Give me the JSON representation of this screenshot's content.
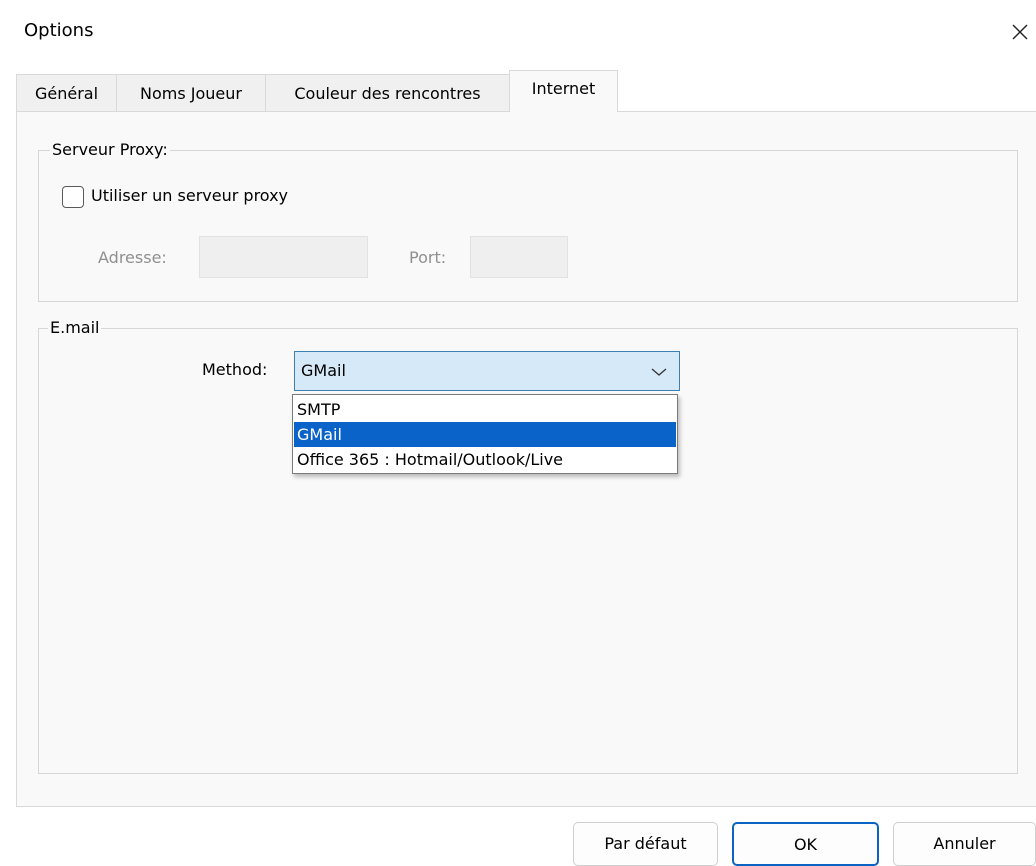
{
  "window": {
    "title": "Options",
    "close_icon": "close-icon"
  },
  "tabs": [
    {
      "label": "Général",
      "active": false
    },
    {
      "label": "Noms Joueur",
      "active": false
    },
    {
      "label": "Couleur des rencontres",
      "active": false
    },
    {
      "label": "Internet",
      "active": true
    }
  ],
  "proxy": {
    "group_label": "Serveur Proxy:",
    "use_proxy_label": "Utiliser un serveur proxy",
    "use_proxy_checked": false,
    "address_label": "Adresse:",
    "address_value": "",
    "port_label": "Port:",
    "port_value": ""
  },
  "email": {
    "group_label": "E.mail",
    "method_label": "Method:",
    "method_value": "GMail",
    "options": [
      "SMTP",
      "GMail",
      "Office 365 : Hotmail/Outlook/Live"
    ],
    "selected_option": "GMail"
  },
  "buttons": {
    "default_label": "Par défaut",
    "ok_label": "OK",
    "cancel_label": "Annuler"
  },
  "colors": {
    "accent": "#0a63c9",
    "combo_background": "#d6e9f8"
  }
}
